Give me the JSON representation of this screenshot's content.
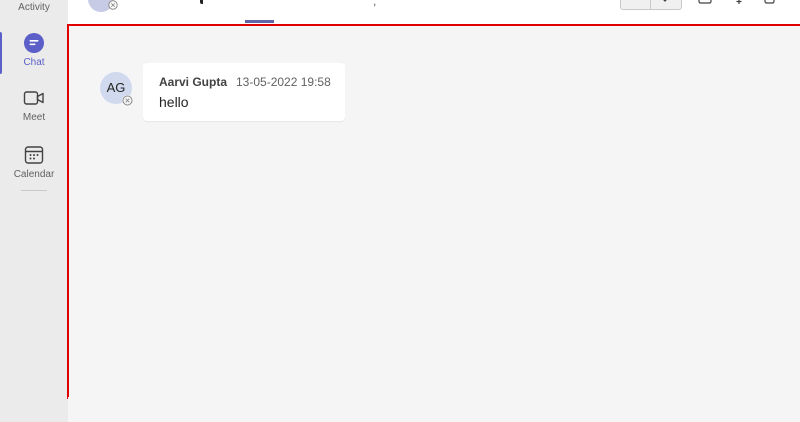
{
  "rail": {
    "items": [
      {
        "label": "Activity",
        "icon": "bell-icon"
      },
      {
        "label": "Chat",
        "icon": "chat-icon",
        "active": true
      },
      {
        "label": "Meet",
        "icon": "video-camera-icon"
      },
      {
        "label": "Calendar",
        "icon": "calendar-icon"
      }
    ]
  },
  "header": {
    "comma": ","
  },
  "messages": [
    {
      "avatar_initials": "AG",
      "author": "Aarvi Gupta",
      "timestamp": "13-05-2022 19:58",
      "text": "hello"
    }
  ],
  "colors": {
    "accent": "#5b5fc7",
    "highlight_border": "#e00000",
    "pane_background": "#f5f5f5"
  }
}
